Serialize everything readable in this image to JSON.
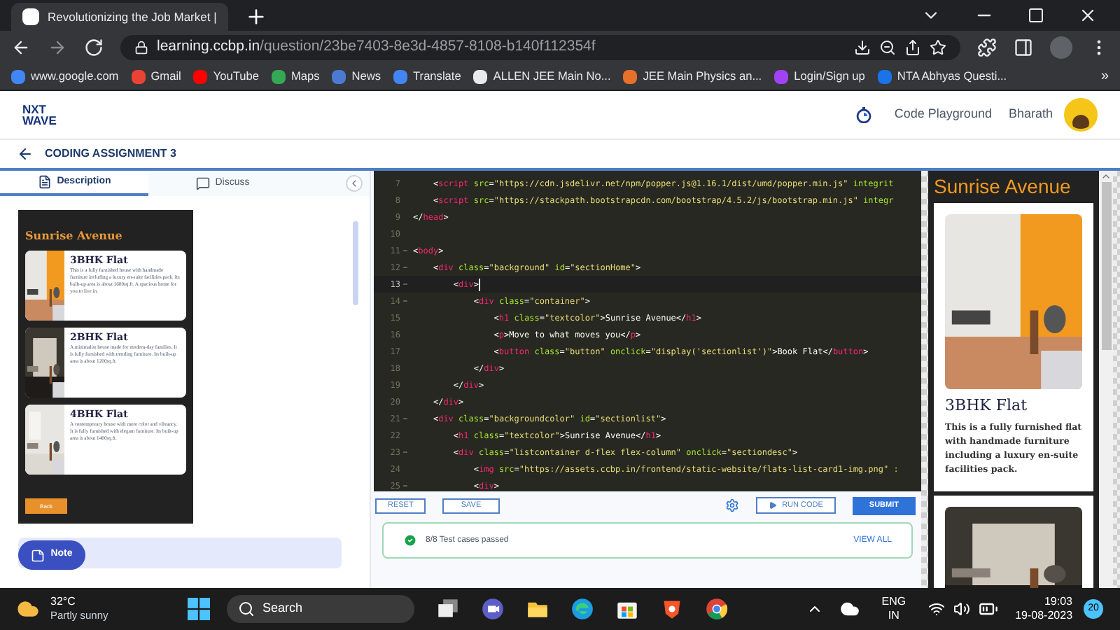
{
  "browser": {
    "tab_title": "Revolutionizing the Job Market |",
    "url_host": "learning.ccbp.in",
    "url_path": "/question/23be7403-8e3d-4857-8108-b140f112354f",
    "bookmarks": [
      {
        "label": "www.google.com",
        "color": "#4285f4"
      },
      {
        "label": "Gmail",
        "color": "#ea4335"
      },
      {
        "label": "YouTube",
        "color": "#ff0000"
      },
      {
        "label": "Maps",
        "color": "#34a853"
      },
      {
        "label": "News",
        "color": "#4a7bd0"
      },
      {
        "label": "Translate",
        "color": "#4285f4"
      },
      {
        "label": "ALLEN JEE Main No...",
        "color": "#e8eaed"
      },
      {
        "label": "JEE Main Physics an...",
        "color": "#e8712a"
      },
      {
        "label": "Login/Sign up",
        "color": "#a142f4"
      },
      {
        "label": "NTA Abhyas Questi...",
        "color": "#1a73e8"
      }
    ],
    "more": "»"
  },
  "header": {
    "logo": [
      "NXT",
      "WAVE"
    ],
    "link": "Code Playground",
    "user": "Bharath"
  },
  "breadcrumb": "CODING ASSIGNMENT 3",
  "left": {
    "tabs": [
      {
        "label": "Description",
        "selected": true
      },
      {
        "label": "Discuss",
        "selected": false
      }
    ],
    "preview": {
      "title": "Sunrise Avenue",
      "button": "Back",
      "cards": [
        {
          "title": "3BHK Flat",
          "text": "This is a fully furnished house with handmade furniture including a luxury en-suite facilities pack. Its built-up area is about 1600sq.ft. A spacious home for you to live in."
        },
        {
          "title": "2BHK Flat",
          "text": "A minimalist house made for modern-day families. It is fully furnished with trending furniture. Its built-up area is about 1200sq.ft."
        },
        {
          "title": "4BHK Flat",
          "text": "A contemporary house with more color and vibrancy. It is fully furnished with elegant furniture. Its built-up area is about 1400sq.ft."
        }
      ]
    },
    "note": "Note"
  },
  "editor": {
    "lines": [
      {
        "num": "7",
        "code": "    <script src=\"https://cdn.jsdelivr.net/npm/popper.js@1.16.1/dist/umd/popper.min.js\" integrit",
        "foldable": false,
        "active": false
      },
      {
        "num": "8",
        "code": "    <script src=\"https://stackpath.bootstrapcdn.com/bootstrap/4.5.2/js/bootstrap.min.js\" integr",
        "foldable": false,
        "active": false
      },
      {
        "num": "9",
        "code": "</head>",
        "foldable": false,
        "active": false
      },
      {
        "num": "10",
        "foldable": false,
        "active": false
      },
      {
        "num": "11",
        "code": "<body>",
        "foldable": true,
        "active": false
      },
      {
        "num": "12",
        "code": "    <div class=\"background\" id=\"sectionHome\">",
        "foldable": true,
        "active": false
      },
      {
        "num": "13",
        "code": "        <div>",
        "foldable": true,
        "active": true
      },
      {
        "num": "14",
        "code": "            <div class=\"container\">",
        "foldable": true,
        "active": false
      },
      {
        "num": "15",
        "code": "                <h1 class=\"textcolor\">Sunrise Avenue</h1>",
        "foldable": false,
        "active": false
      },
      {
        "num": "16",
        "code": "                <p>Move to what moves you</p>",
        "foldable": false,
        "active": false
      },
      {
        "num": "17",
        "code": "                <button class=\"button\" onclick=\"display('sectionlist')\">Book Flat</button>",
        "foldable": false,
        "active": false
      },
      {
        "num": "18",
        "code": "            </div>",
        "foldable": false,
        "active": false
      },
      {
        "num": "19",
        "code": "        </div>",
        "foldable": false,
        "active": false
      },
      {
        "num": "20",
        "code": "    </div>",
        "foldable": false,
        "active": false
      },
      {
        "num": "21",
        "code": "    <div class=\"backgroundcolor\" id=\"sectionlist\">",
        "foldable": true,
        "active": false
      },
      {
        "num": "22",
        "code": "        <h1 class=\"textcolor\">Sunrise Avenue</h1>",
        "foldable": false,
        "active": false
      },
      {
        "num": "23",
        "code": "        <div class=\"listcontainer d-flex flex-column\" onclick=\"sectiondesc\">",
        "foldable": true,
        "active": false
      },
      {
        "num": "24",
        "code": "            <img src=\"https://assets.ccbp.in/frontend/static-website/flats-list-card1-img.png\" :",
        "foldable": false,
        "active": false
      },
      {
        "num": "25",
        "code": "            <div>",
        "foldable": true,
        "active": false
      }
    ]
  },
  "actions": {
    "reset": "RESET",
    "save": "SAVE",
    "run": "RUN CODE",
    "submit": "SUBMIT"
  },
  "result": {
    "text": "8/8 Test cases passed",
    "link": "VIEW ALL"
  },
  "output": {
    "title": "Sunrise Avenue",
    "cards": [
      {
        "kind": "card",
        "title": "3BHK Flat",
        "text": "This is a fully furnished flat with handmade furniture including a luxury en-suite facilities pack."
      },
      {
        "kind": "picture"
      }
    ]
  },
  "taskbar": {
    "temp": "32°C",
    "weather": "Partly sunny",
    "search": "Search",
    "lang": [
      "ENG",
      "IN"
    ],
    "time": "19:03",
    "date": "19-08-2023",
    "badge": "20"
  }
}
